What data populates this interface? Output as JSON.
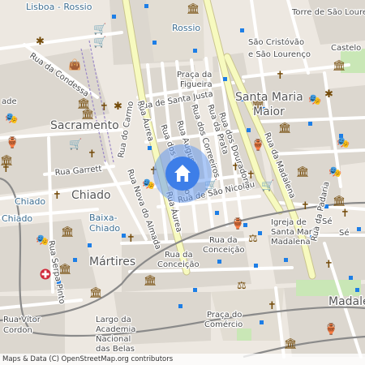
{
  "attribution": "Maps & Data (C) OpenStreetMap.org contributors",
  "labels": {
    "lisboa_rossio": "Lisboa - Rossio",
    "rossio": "Rossio",
    "sao_cristovao_1": "São Cristóvão",
    "sao_cristovao_2": "e São Lourenço",
    "castelo": "Castelo",
    "torre_sao_lourenco": "Torre de São Lourenço",
    "praca_figueira_1": "Praça da",
    "praca_figueira_2": "Figueira",
    "santa_maria_1": "Santa Maria",
    "santa_maria_2": "Maior",
    "rua_condessa": "Rua da Condessa",
    "rua_santa_justa": "Rua de Santa Justa",
    "rua_do_carmo": "Rua do Carmo",
    "rua_aurea_north": "Rua Áurea",
    "rua_aurea_south": "Rua Áurea",
    "rua_sapateiros": "Rua dos Sapateiros",
    "rua_augusta": "Rua Augusta",
    "rua_correeiros": "Rua dos Correeiros",
    "rua_prata": "Rua da Prata",
    "rua_douradores": "Rua dos Douradores",
    "rua_madalena": "Rua da Madalena",
    "rua_sao_nicolau": "Rua de São Nicolau",
    "sacramento": "Sacramento",
    "rua_garrett": "Rua Garrett",
    "rua_nova_almada": "Rua Nova do Almada",
    "chiado_1": "Chiado",
    "chiado_2": "Chiado",
    "baixa_chiado_1": "Baixa-",
    "baixa_chiado_2": "Chiado",
    "martires": "Mártires",
    "rua_serpa_pinto": "Rua Serpa Pinto",
    "rua_vitor_cordon_1": "Rua Vítor",
    "rua_vitor_cordon_2": "Cordon",
    "largo_academia_1": "Largo da",
    "largo_academia_2": "Academia",
    "largo_academia_3": "Nacional",
    "largo_academia_3b": "das Belas",
    "rua_conceicao_1a": "Rua da",
    "rua_conceicao_1b": "Conceição",
    "rua_conceicao_2a": "Rua da",
    "rua_conceicao_2b": "Conceição",
    "igreja_1": "Igreja de",
    "igreja_2": "Santa Maria",
    "igreja_3": "Madalena",
    "rua_padaria": "Rua da Padaria",
    "se_1": "Sé",
    "se_2": "Sé",
    "madalena": "Madalena",
    "praca_comercio_1": "Praça do",
    "praca_comercio_2": "Comércio",
    "ade": "ade"
  },
  "colors": {
    "background": "#ede8e1",
    "block": "#dcd7cf",
    "main_road": "#f7fabf",
    "main_road_casing": "#c9c48e",
    "street": "#ffffff",
    "rail": "#8a8a8a",
    "square": "#e2ddd3",
    "park": "#c9e7b6",
    "poi": "#734a08",
    "marker": "#3d7ee8",
    "marker_halo": "#6a9cf0",
    "stop": "#1d7ee6"
  },
  "marker": {
    "icon": "home-icon"
  },
  "icons": [
    "shopping-cart-icon",
    "church-cross-icon",
    "museum-icon",
    "theatre-icon",
    "monument-icon",
    "bag-icon",
    "hospital-icon",
    "justice-icon",
    "attraction-icon",
    "bus-stop-icon"
  ]
}
